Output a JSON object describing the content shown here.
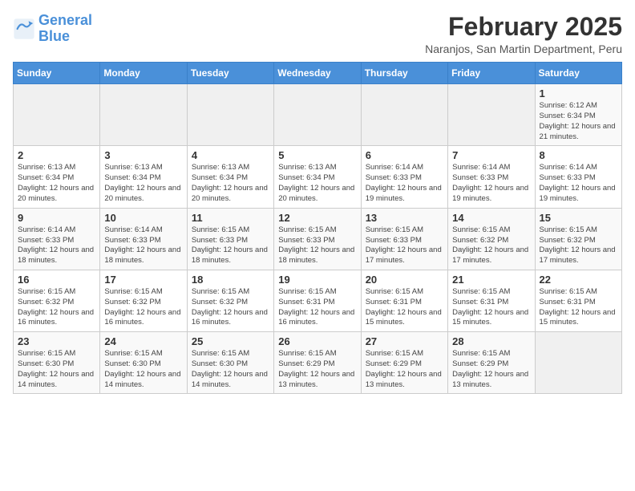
{
  "header": {
    "logo_line1": "General",
    "logo_line2": "Blue",
    "month": "February 2025",
    "location": "Naranjos, San Martin Department, Peru"
  },
  "weekdays": [
    "Sunday",
    "Monday",
    "Tuesday",
    "Wednesday",
    "Thursday",
    "Friday",
    "Saturday"
  ],
  "weeks": [
    [
      {
        "day": "",
        "info": ""
      },
      {
        "day": "",
        "info": ""
      },
      {
        "day": "",
        "info": ""
      },
      {
        "day": "",
        "info": ""
      },
      {
        "day": "",
        "info": ""
      },
      {
        "day": "",
        "info": ""
      },
      {
        "day": "1",
        "info": "Sunrise: 6:12 AM\nSunset: 6:34 PM\nDaylight: 12 hours and 21 minutes."
      }
    ],
    [
      {
        "day": "2",
        "info": "Sunrise: 6:13 AM\nSunset: 6:34 PM\nDaylight: 12 hours and 20 minutes."
      },
      {
        "day": "3",
        "info": "Sunrise: 6:13 AM\nSunset: 6:34 PM\nDaylight: 12 hours and 20 minutes."
      },
      {
        "day": "4",
        "info": "Sunrise: 6:13 AM\nSunset: 6:34 PM\nDaylight: 12 hours and 20 minutes."
      },
      {
        "day": "5",
        "info": "Sunrise: 6:13 AM\nSunset: 6:34 PM\nDaylight: 12 hours and 20 minutes."
      },
      {
        "day": "6",
        "info": "Sunrise: 6:14 AM\nSunset: 6:33 PM\nDaylight: 12 hours and 19 minutes."
      },
      {
        "day": "7",
        "info": "Sunrise: 6:14 AM\nSunset: 6:33 PM\nDaylight: 12 hours and 19 minutes."
      },
      {
        "day": "8",
        "info": "Sunrise: 6:14 AM\nSunset: 6:33 PM\nDaylight: 12 hours and 19 minutes."
      }
    ],
    [
      {
        "day": "9",
        "info": "Sunrise: 6:14 AM\nSunset: 6:33 PM\nDaylight: 12 hours and 18 minutes."
      },
      {
        "day": "10",
        "info": "Sunrise: 6:14 AM\nSunset: 6:33 PM\nDaylight: 12 hours and 18 minutes."
      },
      {
        "day": "11",
        "info": "Sunrise: 6:15 AM\nSunset: 6:33 PM\nDaylight: 12 hours and 18 minutes."
      },
      {
        "day": "12",
        "info": "Sunrise: 6:15 AM\nSunset: 6:33 PM\nDaylight: 12 hours and 18 minutes."
      },
      {
        "day": "13",
        "info": "Sunrise: 6:15 AM\nSunset: 6:33 PM\nDaylight: 12 hours and 17 minutes."
      },
      {
        "day": "14",
        "info": "Sunrise: 6:15 AM\nSunset: 6:32 PM\nDaylight: 12 hours and 17 minutes."
      },
      {
        "day": "15",
        "info": "Sunrise: 6:15 AM\nSunset: 6:32 PM\nDaylight: 12 hours and 17 minutes."
      }
    ],
    [
      {
        "day": "16",
        "info": "Sunrise: 6:15 AM\nSunset: 6:32 PM\nDaylight: 12 hours and 16 minutes."
      },
      {
        "day": "17",
        "info": "Sunrise: 6:15 AM\nSunset: 6:32 PM\nDaylight: 12 hours and 16 minutes."
      },
      {
        "day": "18",
        "info": "Sunrise: 6:15 AM\nSunset: 6:32 PM\nDaylight: 12 hours and 16 minutes."
      },
      {
        "day": "19",
        "info": "Sunrise: 6:15 AM\nSunset: 6:31 PM\nDaylight: 12 hours and 16 minutes."
      },
      {
        "day": "20",
        "info": "Sunrise: 6:15 AM\nSunset: 6:31 PM\nDaylight: 12 hours and 15 minutes."
      },
      {
        "day": "21",
        "info": "Sunrise: 6:15 AM\nSunset: 6:31 PM\nDaylight: 12 hours and 15 minutes."
      },
      {
        "day": "22",
        "info": "Sunrise: 6:15 AM\nSunset: 6:31 PM\nDaylight: 12 hours and 15 minutes."
      }
    ],
    [
      {
        "day": "23",
        "info": "Sunrise: 6:15 AM\nSunset: 6:30 PM\nDaylight: 12 hours and 14 minutes."
      },
      {
        "day": "24",
        "info": "Sunrise: 6:15 AM\nSunset: 6:30 PM\nDaylight: 12 hours and 14 minutes."
      },
      {
        "day": "25",
        "info": "Sunrise: 6:15 AM\nSunset: 6:30 PM\nDaylight: 12 hours and 14 minutes."
      },
      {
        "day": "26",
        "info": "Sunrise: 6:15 AM\nSunset: 6:29 PM\nDaylight: 12 hours and 13 minutes."
      },
      {
        "day": "27",
        "info": "Sunrise: 6:15 AM\nSunset: 6:29 PM\nDaylight: 12 hours and 13 minutes."
      },
      {
        "day": "28",
        "info": "Sunrise: 6:15 AM\nSunset: 6:29 PM\nDaylight: 12 hours and 13 minutes."
      },
      {
        "day": "",
        "info": ""
      }
    ]
  ]
}
